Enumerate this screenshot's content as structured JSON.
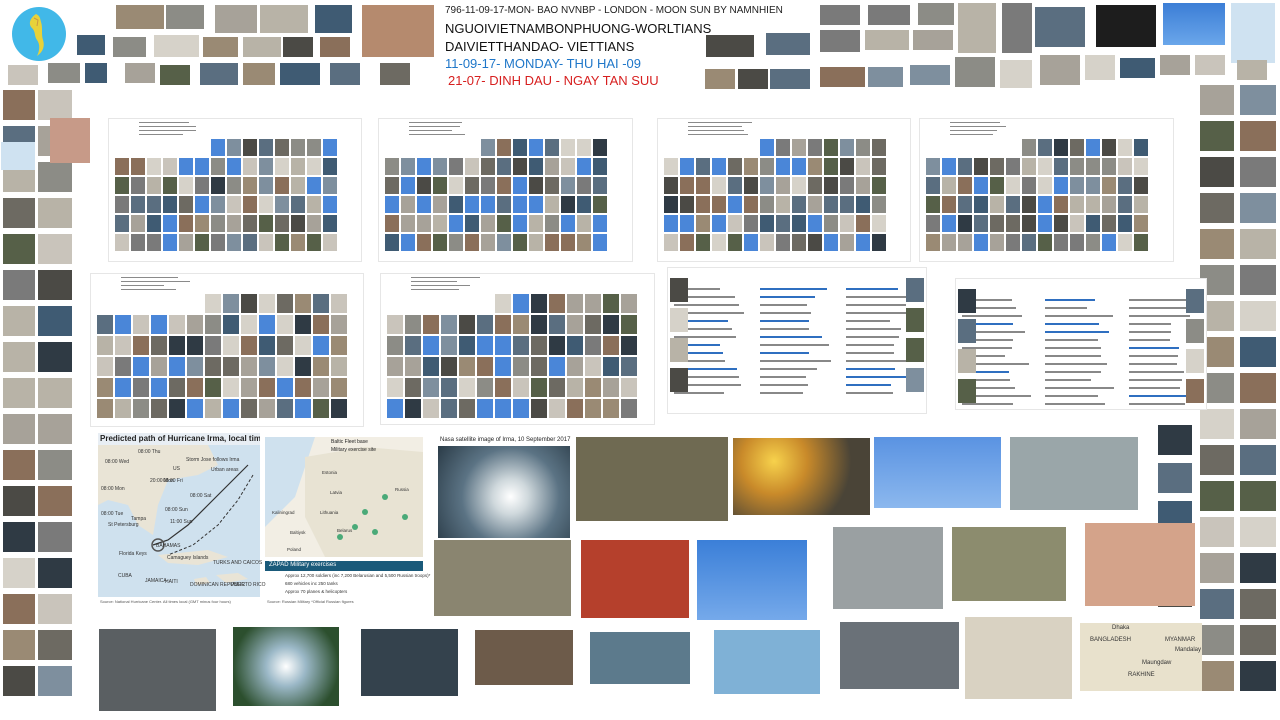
{
  "header": {
    "line1": "796-11-09-17-MON- BAO NVNBP - LONDON - MOON SUN BY NAMNHIEN",
    "line2": "NGUOIVIETNAMBONPHUONG-WORLTIANS",
    "line3": "DAIVIETTHANDAO- VIETTIANS",
    "line4": "11-09-17-  MONDAY- THU HAI -09",
    "line5": "21-07-  DINH DAU  - NGAY TAN SUU"
  },
  "figures": {
    "hurricane_title": "Predicted path of Hurricane Irma, local time",
    "hurricane_source": "Source: National Hurricane Center. All times local (GMT minus four hours)",
    "satellite_title": "Nasa satellite image of Irma, 10 September 2017",
    "zapad_title": "ZAPAD Military exercises",
    "zapad_legend1": "Baltic Fleet base",
    "zapad_legend2": "Military exercise site",
    "zapad_source": "Source: Russian Military *Official Russian figures",
    "hurricane_labels": [
      "08:00 Wed",
      "08:00 Thu",
      "08:00 Fri",
      "08:00 Sat",
      "20:00 Mon",
      "08:00 Mon",
      "08:00 Sun",
      "08:00 Tue",
      "11:00 Sun",
      "Tampa",
      "St Petersburg",
      "Florida Keys",
      "CUBA",
      "BAHAMAS",
      "Camaguey Islands",
      "TURKS AND CAICOS",
      "HAITI",
      "DOMINICAN REPUBLIC",
      "JAMAICA",
      "PUERTO RICO",
      "Urban areas",
      "Storm Jose follows Irma",
      "US"
    ],
    "zapad_labels": [
      "Estonia",
      "Russia",
      "Latvia",
      "Lithuania",
      "Kaliningrad",
      "Belarus",
      "Poland",
      "Baltiysk",
      "Approx 12,700 soldiers (inc 7,200 Belarusian and 5,500 Russian troops)*",
      "680 vehicles inc 250 tanks",
      "Approx 70 planes & helicopters"
    ],
    "bay_labels": [
      "Dhaka",
      "BANGLADESH",
      "MYANMAR",
      "Maungdaw",
      "RAKHINE",
      "Mandalay"
    ]
  }
}
